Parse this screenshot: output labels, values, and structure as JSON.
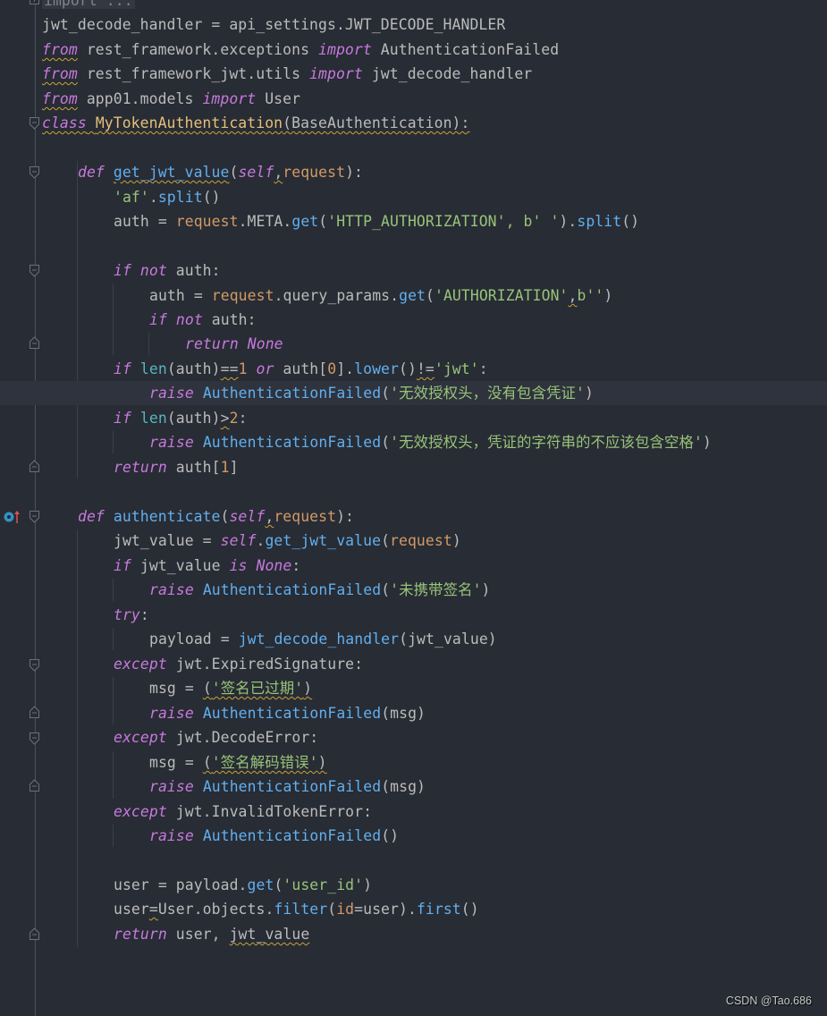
{
  "editor": {
    "language": "python",
    "theme_colors": {
      "background": "#282c34",
      "keyword": "#c679dd",
      "function": "#61afef",
      "class": "#e5c07b",
      "string": "#98c379",
      "number": "#d19a66",
      "text": "#bbbbbb"
    },
    "lines": [
      {
        "folded_text": "import ..."
      },
      {
        "text": "jwt_decode_handler = api_settings.JWT_DECODE_HANDLER"
      },
      {
        "kw1": "from",
        "mod": " rest_framework.exceptions ",
        "kw2": "import",
        "name": " AuthenticationFailed"
      },
      {
        "kw1": "from",
        "mod": " rest_framework_jwt.utils ",
        "kw2": "import",
        "name": " jwt_decode_handler"
      },
      {
        "kw1": "from",
        "mod": " app01.models ",
        "kw2": "import",
        "name": " User"
      },
      {
        "kw": "class",
        "name": "MyTokenAuthentication",
        "rest": "(BaseAuthentication):"
      },
      {
        "kw": "def",
        "name": "get_jwt_value",
        "self": "self",
        "param": "request",
        "p_open": "(",
        "comma": ",",
        "p_close": "):"
      },
      {
        "str": "'af'",
        "dot": ".",
        "fn": "split",
        "rest": "()"
      },
      {
        "a": "auth = ",
        "req": "request",
        "b": ".META.",
        "fn": "get",
        "c": "(",
        "str": "'HTTP_AUTHORIZATION', b' '",
        "d": ").",
        "fn2": "split",
        "e": "()"
      },
      {
        "kw": "if",
        "kw2": "not",
        "rest": " auth:"
      },
      {
        "a": "auth = ",
        "req": "request",
        "b": ".query_params.",
        "fn": "get",
        "c": "(",
        "str": "'AUTHORIZATION'",
        "comma": ",",
        "str2": "b''",
        "d": ")"
      },
      {
        "kw": "if",
        "kw2": "not",
        "rest": " auth:"
      },
      {
        "kw": "return",
        "kw2": "None"
      },
      {
        "kw": "if",
        "builtin": "len",
        "a": "(auth)",
        "op": "==",
        "num": "1",
        "kw2": "or",
        "b": " auth[",
        "num2": "0",
        "c": "].",
        "fn": "lower",
        "d": "()",
        "op2": "!=",
        "str": "'jwt'",
        "e": ":"
      },
      {
        "kw": "raise",
        "cls": "AuthenticationFailed",
        "a": "(",
        "str": "'无效授权头，没有包含凭证'",
        "b": ")"
      },
      {
        "kw": "if",
        "builtin": "len",
        "a": "(auth)",
        "op": ">",
        "num": "2",
        "e": ":"
      },
      {
        "kw": "raise",
        "cls": "AuthenticationFailed",
        "a": "(",
        "str": "'无效授权头，凭证的字符串的不应该包含空格'",
        "b": ")"
      },
      {
        "kw": "return",
        "a": " auth[",
        "num": "1",
        "b": "]"
      },
      {
        "kw": "def",
        "name": "authenticate",
        "self": "self",
        "param": "request",
        "p_open": "(",
        "comma": ",",
        "p_close": "):"
      },
      {
        "a": "jwt_value = ",
        "self": "self",
        "b": ".",
        "fn": "get_jwt_value",
        "c": "(",
        "param": "request",
        "d": ")"
      },
      {
        "kw": "if",
        "a": " jwt_value ",
        "kw2": "is",
        "kw3": "None",
        "b": ":"
      },
      {
        "kw": "raise",
        "cls": "AuthenticationFailed",
        "a": "(",
        "str": "'未携带签名'",
        "b": ")"
      },
      {
        "kw": "try",
        "b": ":"
      },
      {
        "a": "payload = ",
        "fn": "jwt_decode_handler",
        "b": "(jwt_value)"
      },
      {
        "kw": "except",
        "rest": " jwt.ExpiredSignature:"
      },
      {
        "a": "msg = ",
        "p_open": "(",
        "str": "'签名已过期'",
        "p_close": ")"
      },
      {
        "kw": "raise",
        "cls": "AuthenticationFailed",
        "rest": "(msg)"
      },
      {
        "kw": "except",
        "rest": " jwt.DecodeError:"
      },
      {
        "a": "msg = ",
        "p_open": "(",
        "str": "'签名解码错误'",
        "p_close": ")"
      },
      {
        "kw": "raise",
        "cls": "AuthenticationFailed",
        "rest": "(msg)"
      },
      {
        "kw": "except",
        "rest": " jwt.InvalidTokenError:"
      },
      {
        "kw": "raise",
        "cls": "AuthenticationFailed",
        "rest": "()"
      },
      {
        "a": "user = payload.",
        "fn": "get",
        "b": "(",
        "str": "'user_id'",
        "c": ")"
      },
      {
        "a": "user",
        "op": "=",
        "b": "User.objects.",
        "fn": "filter",
        "c": "(",
        "param": "id",
        "d": "=user).",
        "fn2": "first",
        "e": "()"
      },
      {
        "kw": "return",
        "a": " user, ",
        "warn": "jwt_value"
      }
    ]
  },
  "gutter": {
    "override_marker_icon": "implements-method-icon"
  },
  "watermark": "CSDN @Tao.686"
}
